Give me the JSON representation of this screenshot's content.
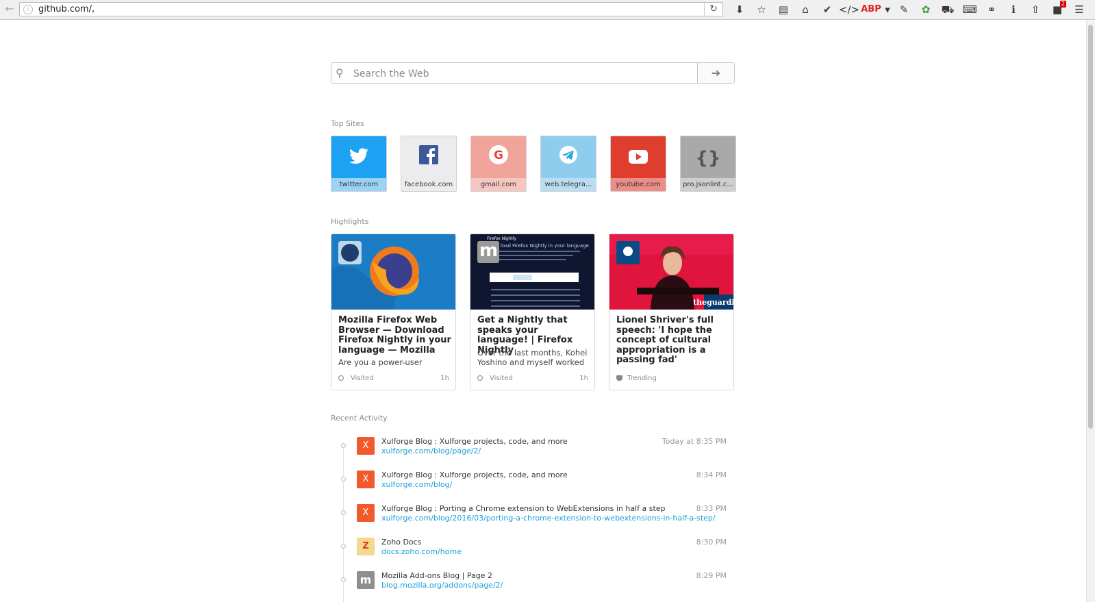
{
  "browser": {
    "url": "github.com/,",
    "toolbar_icons": [
      "download-icon",
      "bookmark-star-icon",
      "reading-list-icon",
      "home-icon",
      "check-circle-icon",
      "code-icon",
      "adblock-icon",
      "dropdown-arrow-icon",
      "notepad-icon",
      "puzzle-icon",
      "car-icon",
      "keyboard-icon",
      "globe-icon",
      "info-icon",
      "share-icon",
      "notification-icon",
      "menu-icon"
    ],
    "adblock_label": "ABP",
    "notification_badge": "2"
  },
  "search": {
    "placeholder": "Search the Web"
  },
  "top_sites": {
    "heading": "Top Sites",
    "tiles": [
      {
        "label": "twitter.com",
        "icon": "twitter-icon",
        "bg": "#1da1f2",
        "label_bg": "#9bd3f7"
      },
      {
        "label": "facebook.com",
        "icon": "facebook-icon",
        "bg": "#ececee",
        "label_bg": "#ececee"
      },
      {
        "label": "gmail.com",
        "icon": "google-icon",
        "bg": "#f0a49a",
        "label_bg": "#f6c7c1"
      },
      {
        "label": "web.telegra...",
        "icon": "telegram-icon",
        "bg": "#8fcdef",
        "label_bg": "#b9def3"
      },
      {
        "label": "youtube.com",
        "icon": "youtube-icon",
        "bg": "#df3e2f",
        "label_bg": "#ec8e85"
      },
      {
        "label": "pro.jsonlint.c...",
        "icon": "json-braces-icon",
        "bg": "#a9a9a9",
        "label_bg": "#cfcfcf"
      }
    ]
  },
  "highlights": {
    "heading": "Highlights",
    "cards": [
      {
        "title": "Mozilla Firefox Web Browser — Download Firefox Nightly in your language — Mozilla",
        "desc": "Are you a power-user",
        "status": "Visited",
        "age": "1h"
      },
      {
        "title": "Get a Nightly that speaks your language! | Firefox Nightly",
        "desc": "Over the last months, Kohei Yoshino and myself worked",
        "status": "Visited",
        "age": "1h",
        "img_letter": "m",
        "img_header": "Firefox Nightly",
        "img_subheader": "load Firefox Nightly in your language"
      },
      {
        "title": "Lionel Shriver's full speech: 'I hope the concept of cultural appropriation is a passing fad'",
        "desc": "",
        "status": "Trending",
        "age": "",
        "img_brand": "theguardia"
      }
    ]
  },
  "recent_activity": {
    "heading": "Recent Activity",
    "items": [
      {
        "title": "Xulforge Blog : Xulforge projects, code, and more",
        "url": "xulforge.com/blog/page/2/",
        "time": "Today at 8:35 PM",
        "icon_letter": "X",
        "icon_bg": "#f2592b"
      },
      {
        "title": "Xulforge Blog : Xulforge projects, code, and more",
        "url": "xulforge.com/blog/",
        "time": "8:34 PM",
        "icon_letter": "X",
        "icon_bg": "#f2592b"
      },
      {
        "title": "Xulforge Blog : Porting a Chrome extension to WebExtensions in half a step",
        "url": "xulforge.com/blog/2016/03/porting-a-chrome-extension-to-webextensions-in-half-a-step/",
        "time": "8:33 PM",
        "icon_letter": "X",
        "icon_bg": "#f2592b"
      },
      {
        "title": "Zoho Docs",
        "url": "docs.zoho.com/home",
        "time": "8:30 PM",
        "icon_letter": "Z",
        "icon_bg": "#f3d98a"
      },
      {
        "title": "Mozilla Add-ons Blog | Page 2",
        "url": "blog.mozilla.org/addons/page/2/",
        "time": "8:29 PM",
        "icon_letter": "m",
        "icon_bg": "#8e8e8e"
      }
    ]
  }
}
